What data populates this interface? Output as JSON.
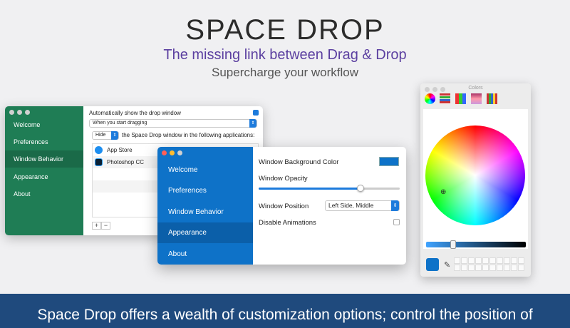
{
  "hero": {
    "title": "SPACE DROP",
    "tagline": "The missing link between Drag & Drop",
    "subtagline": "Supercharge your workflow"
  },
  "window1": {
    "sidebar": [
      "Welcome",
      "Preferences",
      "Window Behavior",
      "Appearance",
      "About"
    ],
    "active_index": 2,
    "auto_show_label": "Automatically show the drop window",
    "auto_show_checked": true,
    "trigger_value": "When you start dragging",
    "hide_value": "Hide",
    "apps_label": "the Space Drop window in the following applications:",
    "apps": [
      {
        "name": "App Store",
        "icon": "app-store-icon"
      },
      {
        "name": "Photoshop CC",
        "icon": "photoshop-icon"
      }
    ],
    "add_label": "+",
    "remove_label": "−"
  },
  "window2": {
    "sidebar": [
      "Welcome",
      "Preferences",
      "Window Behavior",
      "Appearance",
      "About"
    ],
    "active_index": 3,
    "bg_color_label": "Window Background Color",
    "bg_color": "#0e72c8",
    "opacity_label": "Window Opacity",
    "opacity_value": 0.72,
    "position_label": "Window Position",
    "position_value": "Left Side, Middle",
    "disable_anim_label": "Disable Animations",
    "disable_anim_checked": false
  },
  "colors_panel": {
    "title": "Colors",
    "current_color": "#0e72c8"
  },
  "banner": {
    "text": "Space Drop offers a wealth of customization options; control the position of"
  }
}
